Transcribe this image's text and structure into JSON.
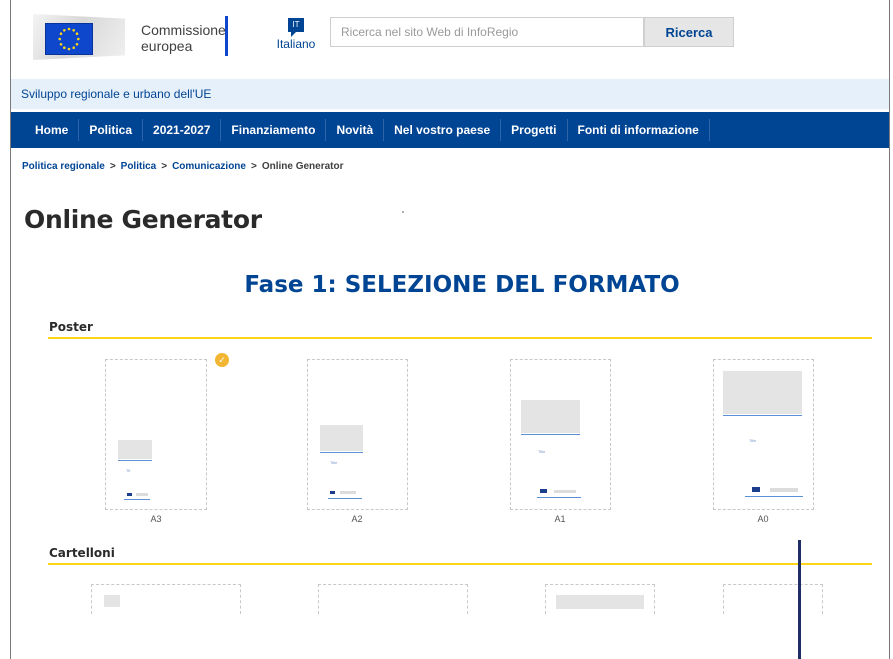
{
  "header": {
    "logo_line1": "Commissione",
    "logo_line2": "europea",
    "language_code": "IT",
    "language_label": "Italiano",
    "search_placeholder": "Ricerca nel sito Web di InfoRegio",
    "search_button": "Ricerca"
  },
  "site_name": "Sviluppo regionale e urbano dell'UE",
  "nav": {
    "items": [
      "Home",
      "Politica",
      "2021-2027",
      "Finanziamento",
      "Novità",
      "Nel vostro paese",
      "Progetti",
      "Fonti di informazione"
    ]
  },
  "breadcrumb": {
    "items": [
      "Politica regionale",
      "Politica",
      "Comunicazione"
    ],
    "separator": ">",
    "current": "Online Generator"
  },
  "page_title": "Online Generator",
  "step_title": "Fase 1: SELEZIONE DEL FORMATO",
  "sections": {
    "poster": {
      "label": "Poster",
      "formats": [
        {
          "label": "A3",
          "selected": true,
          "thumb_text": "Tit"
        },
        {
          "label": "A2",
          "selected": false,
          "thumb_text": "Title"
        },
        {
          "label": "A1",
          "selected": false,
          "thumb_text": "Title"
        },
        {
          "label": "A0",
          "selected": false,
          "thumb_text": "Title"
        }
      ]
    },
    "cartelloni": {
      "label": "Cartelloni"
    }
  },
  "colors": {
    "brand_blue": "#004494",
    "accent_yellow": "#ffd617",
    "selected_badge": "#f2b632"
  },
  "icons": {
    "selected": "check-icon",
    "flag": "eu-flag-icon"
  }
}
